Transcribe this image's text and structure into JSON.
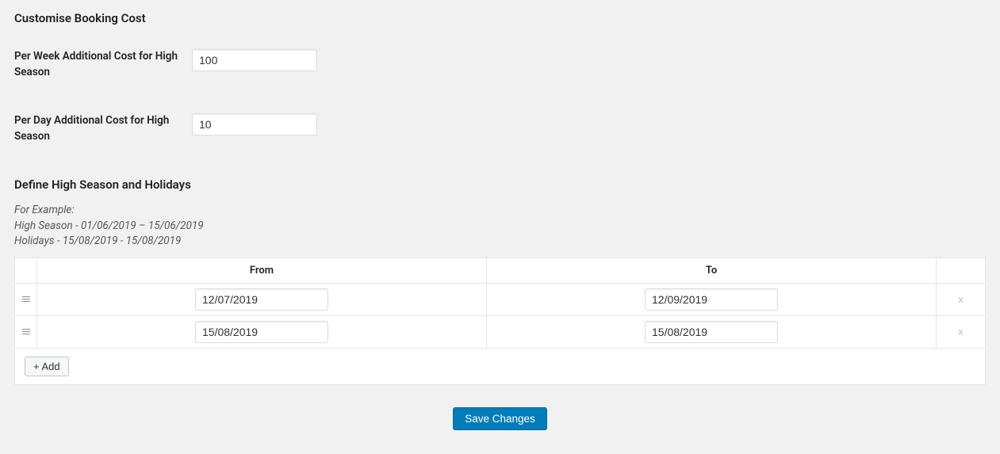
{
  "section1": {
    "title": "Customise Booking Cost",
    "perWeek": {
      "label": "Per Week Additional Cost for High Season",
      "value": "100"
    },
    "perDay": {
      "label": "Per Day Additional Cost for High Season",
      "value": "10"
    }
  },
  "section2": {
    "title": "Define High Season and Holidays",
    "example": {
      "line1": "For Example:",
      "line2": "High Season - 01/06/2019 – 15/06/2019",
      "line3": "Holidays - 15/08/2019 - 15/08/2019"
    },
    "columns": {
      "from": "From",
      "to": "To"
    },
    "rows": [
      {
        "from": "12/07/2019",
        "to": "12/09/2019"
      },
      {
        "from": "15/08/2019",
        "to": "15/08/2019"
      }
    ],
    "addButton": "+ Add"
  },
  "saveButton": "Save Changes"
}
